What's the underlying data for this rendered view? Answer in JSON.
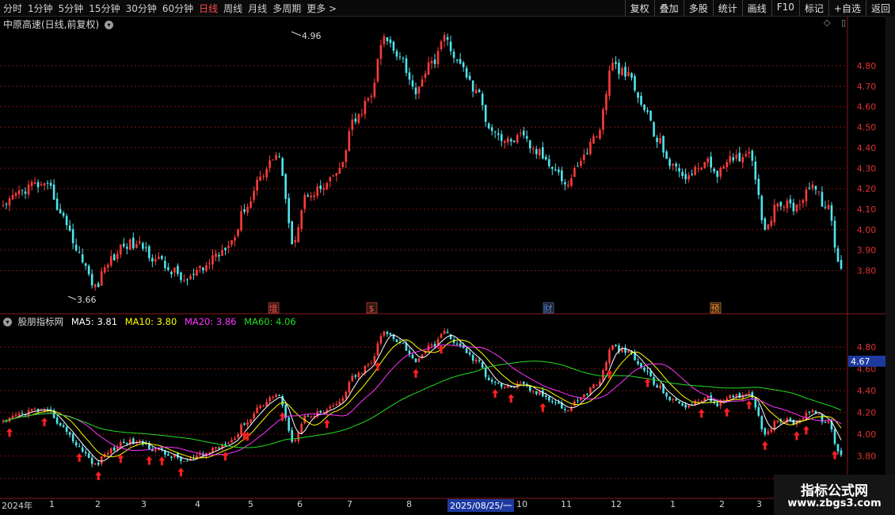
{
  "toolbar": {
    "periods": [
      "分时",
      "1分钟",
      "5分钟",
      "15分钟",
      "30分钟",
      "60分钟",
      "日线",
      "周线",
      "月线",
      "多周期",
      "更多 >"
    ],
    "active_period": "日线",
    "right_buttons": [
      "复权",
      "叠加",
      "多股",
      "统计",
      "画线",
      "F10",
      "标记",
      "+自选",
      "返回"
    ]
  },
  "main_chart": {
    "title": "中原高速(日线,前复权)",
    "max_label": "4.96",
    "min_label": "3.66",
    "y_ticks": [
      "4.80",
      "4.70",
      "4.60",
      "4.50",
      "4.40",
      "4.30",
      "4.20",
      "4.10",
      "4.00",
      "3.90",
      "3.80"
    ],
    "event_markers": [
      {
        "label": "增",
        "color": "#ff4b4b"
      },
      {
        "label": "$",
        "color": "#ff4b4b"
      },
      {
        "label": "财",
        "color": "#3b8bff"
      },
      {
        "label": "预",
        "color": "#ff9a2e"
      }
    ]
  },
  "indicator": {
    "name": "股朋指标网",
    "ma5": "MA5: 3.81",
    "ma10": "MA10: 3.80",
    "ma20": "MA20: 3.86",
    "ma60": "MA60: 4.06",
    "current_price_label": "4.67",
    "y_ticks": [
      "4.80",
      "4.60",
      "4.40",
      "4.20",
      "4.00",
      "3.80"
    ]
  },
  "x_axis": {
    "labels": [
      "2024年",
      "1",
      "2",
      "3",
      "4",
      "5",
      "6",
      "7",
      "8",
      "2025/08/25/一",
      "10",
      "11",
      "12",
      "1",
      "2",
      "3"
    ]
  },
  "watermark": {
    "line1": "指标公式网",
    "line2": "www.zbgs3.com"
  },
  "colors": {
    "up": "#ff3b3b",
    "down": "#4ee5ee",
    "ma5": "#ffffff",
    "ma10": "#ffff00",
    "ma20": "#ff33ff",
    "ma60": "#22dd22",
    "grid": "#7a1010"
  },
  "chart_data": {
    "type": "candlestick",
    "series": [
      {
        "name": "K线",
        "values": [
          4.1,
          4.18,
          4.22,
          4.2,
          4.05,
          3.88,
          3.72,
          3.85,
          3.93,
          3.92,
          3.86,
          3.8,
          3.75,
          3.8,
          3.88,
          3.95,
          4.12,
          4.28,
          4.37,
          3.95,
          4.18,
          4.2,
          4.28,
          4.52,
          4.63,
          4.93,
          4.86,
          4.68,
          4.8,
          4.93,
          4.8,
          4.68,
          4.5,
          4.43,
          4.45,
          4.38,
          4.32,
          4.22,
          4.35,
          4.47,
          4.8,
          4.75,
          4.6,
          4.43,
          4.3,
          4.26,
          4.33,
          4.28,
          4.35,
          4.38,
          4.02,
          4.13,
          4.11,
          4.22,
          4.12,
          3.81
        ]
      },
      {
        "name": "MA5",
        "label": "MA5: 3.81"
      },
      {
        "name": "MA10",
        "label": "MA10: 3.80"
      },
      {
        "name": "MA20",
        "label": "MA20: 3.86"
      },
      {
        "name": "MA60",
        "label": "MA60: 4.06"
      }
    ],
    "ylim": [
      3.66,
      4.96
    ],
    "high": 4.96,
    "low": 3.66
  }
}
